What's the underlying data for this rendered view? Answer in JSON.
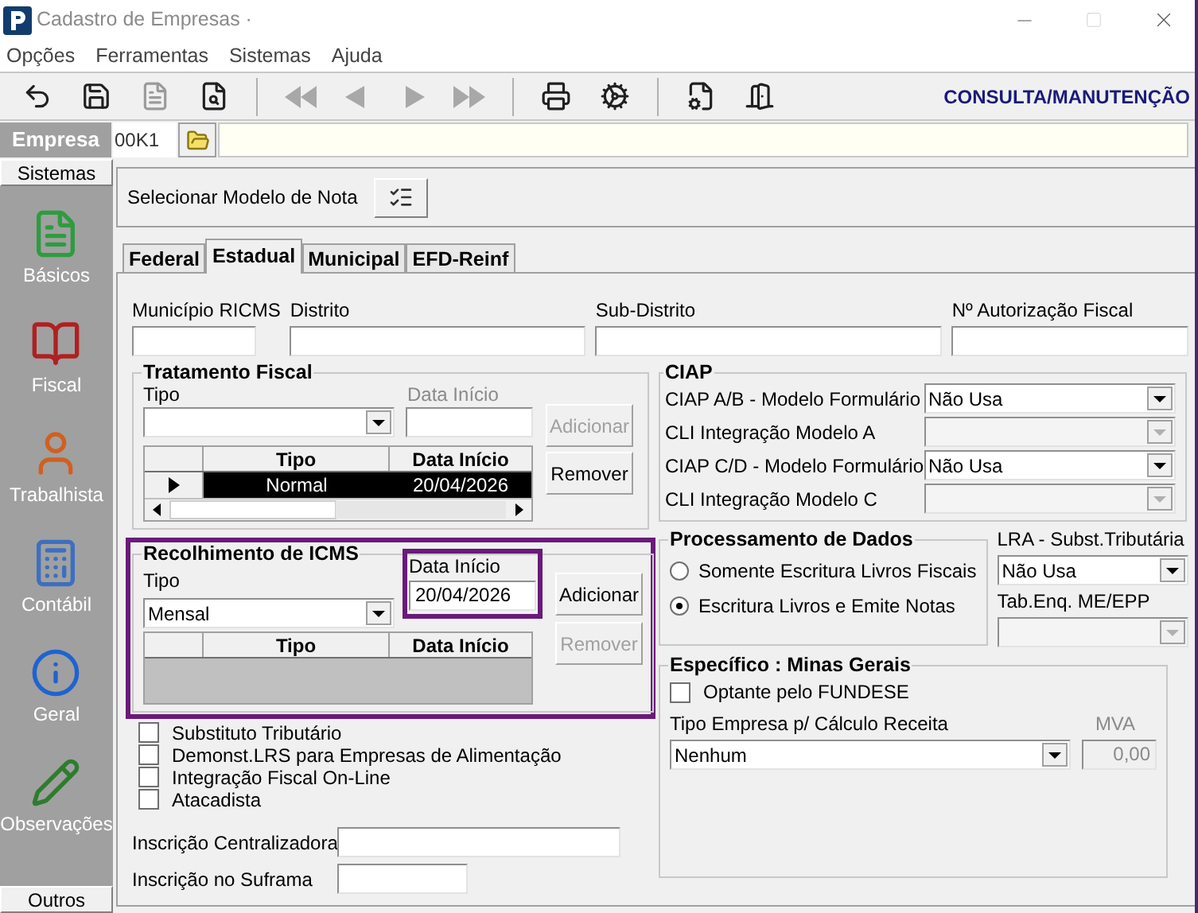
{
  "window": {
    "title": "Cadastro de Empresas ·"
  },
  "menu": [
    {
      "label": "Opções"
    },
    {
      "label": "Ferramentas"
    },
    {
      "label": "Sistemas"
    },
    {
      "label": "Ajuda"
    }
  ],
  "toolbar": {
    "buttons": [
      {
        "disabled": false
      },
      {
        "disabled": false
      },
      {
        "disabled": true
      },
      {
        "disabled": false
      },
      {
        "disabled": true
      },
      {
        "disabled": true
      },
      {
        "disabled": true
      },
      {
        "disabled": true
      },
      {
        "disabled": false
      },
      {
        "disabled": false
      },
      {
        "disabled": false
      },
      {
        "disabled": false
      }
    ],
    "mode": "CONSULTA/MANUTENÇÃO"
  },
  "empresa": {
    "label": "Empresa",
    "code": "00K1"
  },
  "sidebar": {
    "header": "Sistemas",
    "items": [
      {
        "label": "Básicos"
      },
      {
        "label": "Fiscal"
      },
      {
        "label": "Trabalhista"
      },
      {
        "label": "Contábil"
      },
      {
        "label": "Geral"
      },
      {
        "label": "Observações"
      }
    ],
    "footer": "Outros"
  },
  "modelo_nota": {
    "label": "Selecionar Modelo de Nota"
  },
  "tabs": [
    {
      "label": "Federal",
      "selected": false
    },
    {
      "label": "Estadual",
      "selected": true
    },
    {
      "label": "Municipal",
      "selected": false
    },
    {
      "label": "EFD-Reinf",
      "selected": false
    }
  ],
  "top_fields": [
    {
      "label": "Município RICMS"
    },
    {
      "label": "Distrito"
    },
    {
      "label": "Sub-Distrito"
    },
    {
      "label": "Nº Autorização Fiscal"
    }
  ],
  "tratamento_fiscal": {
    "title": "Tratamento Fiscal",
    "tipo_label": "Tipo",
    "data_label": "Data Início",
    "data_disabled": true,
    "add_button": {
      "label": "Adicionar",
      "disabled": true
    },
    "remove_button": {
      "label": "Remover",
      "disabled": false
    },
    "columns": [
      "Tipo",
      "Data Início"
    ],
    "rows": [
      {
        "tipo": "Normal",
        "data": "20/04/2026",
        "selected": true
      }
    ]
  },
  "recolhimento_icms": {
    "title": "Recolhimento de ICMS",
    "highlighted": true,
    "tipo_label": "Tipo",
    "tipo_value": "Mensal",
    "data_label": "Data Início",
    "data_value": "20/04/2026",
    "data_highlighted": true,
    "add_button": {
      "label": "Adicionar",
      "disabled": false
    },
    "remove_button": {
      "label": "Remover",
      "disabled": true
    },
    "columns": [
      "Tipo",
      "Data Início"
    ]
  },
  "checkboxes": [
    {
      "label": "Substituto Tributário",
      "checked": false
    },
    {
      "label": "Demonst.LRS para Empresas de Alimentação",
      "checked": false
    },
    {
      "label": "Integração Fiscal On-Line",
      "checked": false
    },
    {
      "label": "Atacadista",
      "checked": false
    }
  ],
  "inscricoes": [
    {
      "label": "Inscrição Centralizadora"
    },
    {
      "label": "Inscrição no Suframa"
    }
  ],
  "ciap": {
    "title": "CIAP",
    "rows": [
      {
        "label": "CIAP  A/B - Modelo Formulário",
        "value": "Não Usa",
        "disabled": false
      },
      {
        "label": "CLI Integração Modelo A",
        "disabled": true
      },
      {
        "label": "CIAP C/D - Modelo Formulário",
        "value": "Não Usa",
        "disabled": false
      },
      {
        "label": "CLI Integração Modelo C",
        "disabled": true
      }
    ]
  },
  "processamento": {
    "title": "Processamento de Dados",
    "options": [
      {
        "label": "Somente Escritura Livros Fiscais",
        "selected": false
      },
      {
        "label": "Escritura Livros e Emite Notas",
        "selected": true
      }
    ]
  },
  "lra": {
    "label": "LRA - Subst.Tributária",
    "value": "Não Usa",
    "disabled": false
  },
  "tab_enq": {
    "label": "Tab.Enq. ME/EPP",
    "disabled": true
  },
  "especifico": {
    "title": "Específico : Minas Gerais",
    "fundese": {
      "label": "Optante pelo FUNDESE",
      "checked": false
    },
    "tipo_label": "Tipo Empresa p/ Cálculo Receita",
    "tipo_value": "Nenhum",
    "mva_label": "MVA",
    "mva_value": "0,00",
    "mva_disabled": true
  }
}
